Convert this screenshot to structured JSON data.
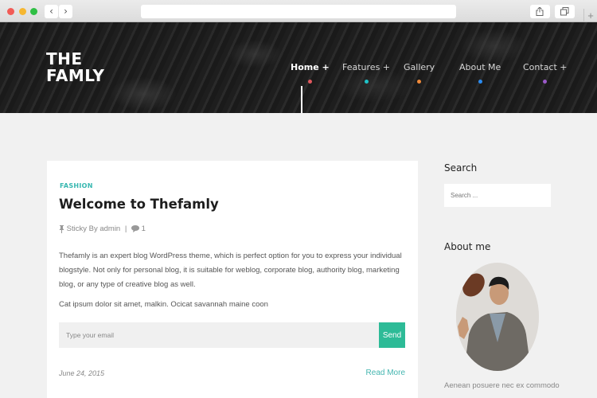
{
  "browser": {
    "back_icon": "‹",
    "forward_icon": "›",
    "url": "",
    "new_tab_icon": "+"
  },
  "header": {
    "logo_line1": "THE",
    "logo_line2": "FAMLY",
    "menu": [
      {
        "label": "Home +",
        "dot_color": "#e0585e",
        "active": true
      },
      {
        "label": "Features +",
        "dot_color": "#1fc3c8",
        "active": false
      },
      {
        "label": "Gallery",
        "dot_color": "#f08a3a",
        "active": false
      },
      {
        "label": "About Me",
        "dot_color": "#2a8bf0",
        "active": false
      },
      {
        "label": "Contact +",
        "dot_color": "#9b59c9",
        "active": false
      }
    ]
  },
  "post": {
    "category": "FASHION",
    "title": "Welcome to Thefamly",
    "pin_icon": "pin-icon",
    "meta_text": "Sticky By admin",
    "meta_separator": "|",
    "comment_icon": "comment-icon",
    "comment_count": "1",
    "excerpt": "Thefamly is an expert blog WordPress theme, which is perfect option for you to express your individual blogstyle. Not only for personal blog, it is suitable for weblog, corporate blog, authority blog, marketing blog, or any type of creative blog as well.",
    "excerpt2": "Cat ipsum dolor sit amet, malkin. Ocicat savannah maine coon",
    "email_placeholder": "Type your email",
    "send_label": "Send",
    "date": "June 24, 2015",
    "read_more": "Read More"
  },
  "sidebar": {
    "search_title": "Search",
    "search_placeholder": "Search ...",
    "about_title": "About me",
    "about_text": "Aenean posuere nec ex commodo",
    "about_text2": "..."
  },
  "colors": {
    "accent": "#2dbb97",
    "link": "#45b6b0",
    "category": "#37b7b0"
  }
}
